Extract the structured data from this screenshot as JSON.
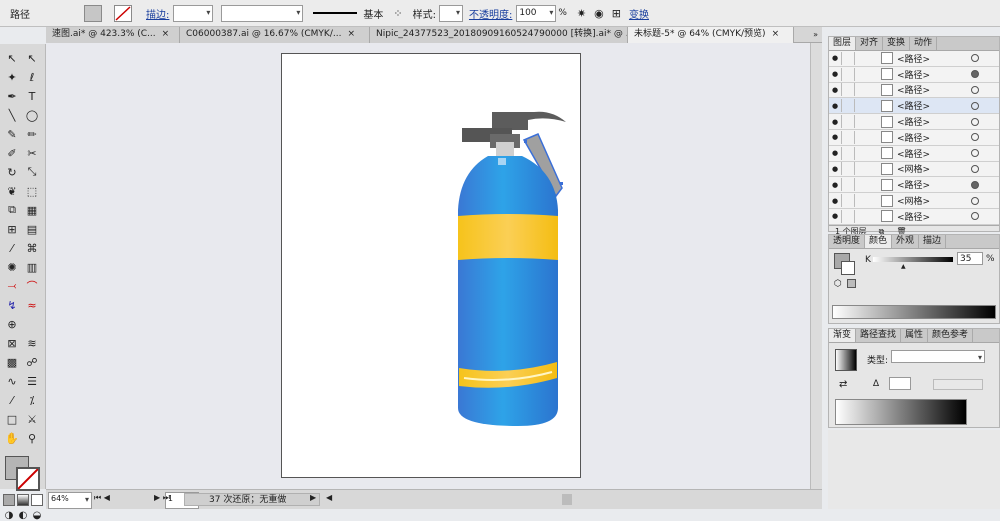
{
  "control_bar": {
    "object_type": "路径",
    "stroke_label": "描边:",
    "basic_label": "基本",
    "style_label": "样式:",
    "opacity_label": "不透明度:",
    "opacity_value": "100",
    "opacity_unit": "%",
    "transform_label": "变换"
  },
  "tabs": [
    {
      "label": "速图.ai* @ 423.3% (C...",
      "active": false
    },
    {
      "label": "C06000387.ai @ 16.67% (CMYK/...",
      "active": false
    },
    {
      "label": "Nipic_24377523_20180909160524790000 [转换].ai* @ ...",
      "active": false
    },
    {
      "label": "未标题-5* @ 64% (CMYK/预览)",
      "active": true
    }
  ],
  "status": {
    "zoom": "64%",
    "page": "1",
    "history": "37 次还原；无重做"
  },
  "layers_panel": {
    "tabs": [
      "图层",
      "对齐",
      "变换",
      "动作"
    ],
    "rows": [
      {
        "name": "<路径>",
        "fill": false
      },
      {
        "name": "<路径>",
        "fill": true
      },
      {
        "name": "<路径>",
        "fill": false
      },
      {
        "name": "<路径>",
        "fill": false
      },
      {
        "name": "<路径>",
        "fill": false
      },
      {
        "name": "<路径>",
        "fill": false
      },
      {
        "name": "<路径>",
        "fill": false
      },
      {
        "name": "<网格>",
        "fill": false
      },
      {
        "name": "<路径>",
        "fill": true
      },
      {
        "name": "<网格>",
        "fill": false
      },
      {
        "name": "<路径>",
        "fill": false
      }
    ],
    "footer": "1 个图层"
  },
  "color_panel": {
    "tabs": [
      "透明度",
      "颜色",
      "外观",
      "描边"
    ],
    "k_label": "K",
    "k_value": "35",
    "k_unit": "%"
  },
  "gradient_panel": {
    "tabs": [
      "渐变",
      "路径查找",
      "属性",
      "颜色参考"
    ],
    "type_label": "类型:"
  },
  "colors": {
    "tank_blue": "#2f9ee6",
    "band_yellow": "#f6c31b",
    "handle_gray": "#5f5f5f",
    "selection": "#3a6fd8"
  }
}
